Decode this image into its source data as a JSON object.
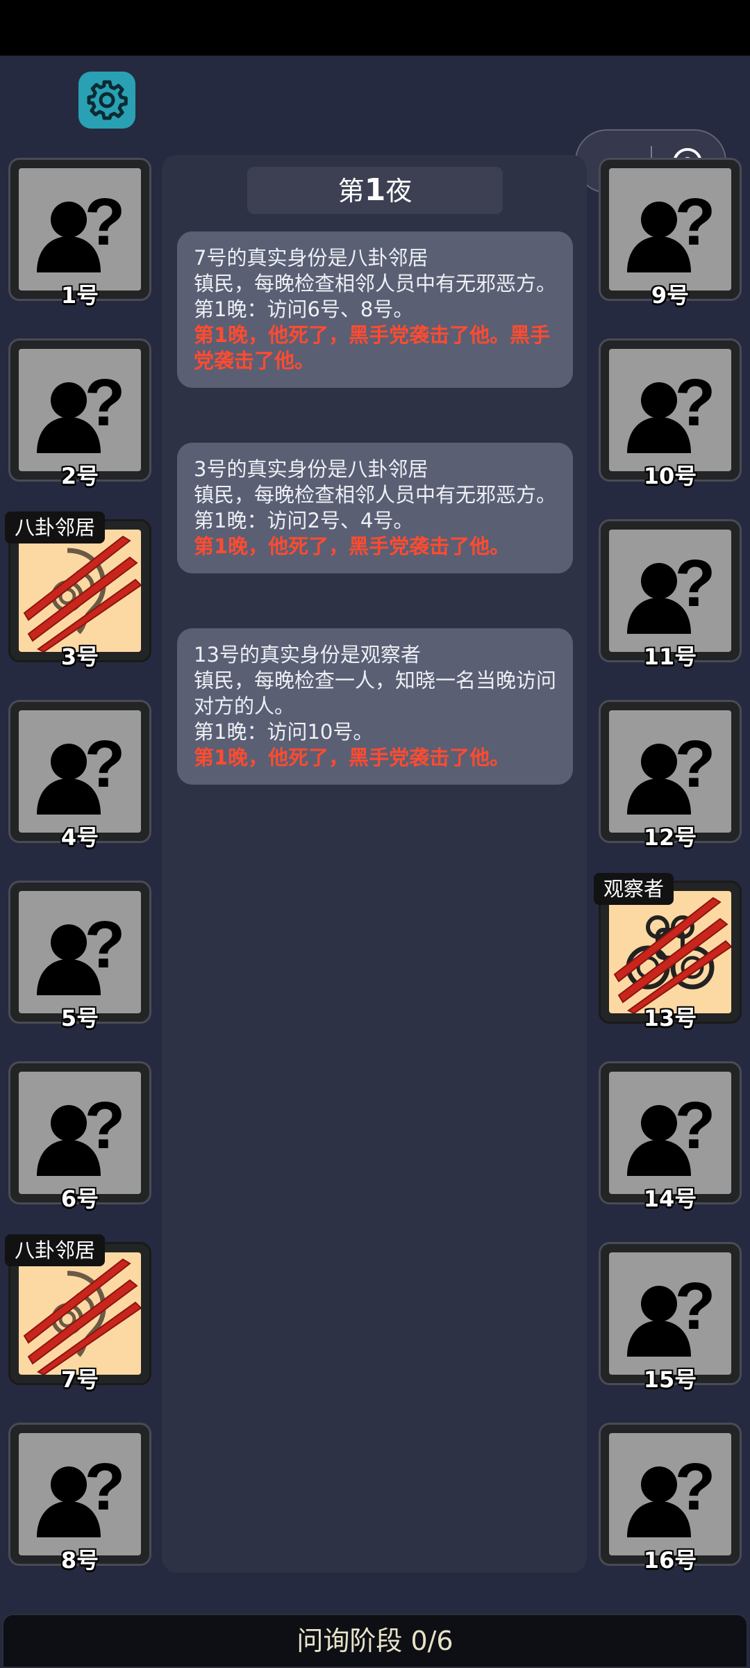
{
  "header": {
    "settings_icon": "gear-icon"
  },
  "capsule": {
    "more_icon": "more-dots-icon",
    "close_icon": "target-close-icon"
  },
  "night": {
    "prefix": "第",
    "number": "1",
    "suffix": "夜"
  },
  "reports": [
    {
      "lines": [
        "7号的真实身份是八卦邻居",
        "镇民，每晚检查相邻人员中有无邪恶方。",
        "第1晚：访问6号、8号。"
      ],
      "death": "第1晚，他死了，黑手党袭击了他。黑手党袭击了他。"
    },
    {
      "lines": [
        "3号的真实身份是八卦邻居",
        "镇民，每晚检查相邻人员中有无邪恶方。",
        "第1晚：访问2号、4号。"
      ],
      "death": "第1晚，他死了，黑手党袭击了他。"
    },
    {
      "lines": [
        "13号的真实身份是观察者",
        "镇民，每晚检查一人，知晓一名当晚访问对方的人。",
        "第1晚：访问10号。"
      ],
      "death": "第1晚，他死了，黑手党袭击了他。"
    }
  ],
  "players_left": [
    {
      "label": "1号",
      "state": "unknown",
      "role": ""
    },
    {
      "label": "2号",
      "state": "unknown",
      "role": ""
    },
    {
      "label": "3号",
      "state": "dead",
      "role": "八卦邻居",
      "icon": "ear-icon"
    },
    {
      "label": "4号",
      "state": "unknown",
      "role": ""
    },
    {
      "label": "5号",
      "state": "unknown",
      "role": ""
    },
    {
      "label": "6号",
      "state": "unknown",
      "role": ""
    },
    {
      "label": "7号",
      "state": "dead",
      "role": "八卦邻居",
      "icon": "ear-icon"
    },
    {
      "label": "8号",
      "state": "unknown",
      "role": ""
    }
  ],
  "players_right": [
    {
      "label": "9号",
      "state": "unknown",
      "role": ""
    },
    {
      "label": "10号",
      "state": "unknown",
      "role": ""
    },
    {
      "label": "11号",
      "state": "unknown",
      "role": ""
    },
    {
      "label": "12号",
      "state": "unknown",
      "role": ""
    },
    {
      "label": "13号",
      "state": "dead",
      "role": "观察者",
      "icon": "binoculars-icon"
    },
    {
      "label": "14号",
      "state": "unknown",
      "role": ""
    },
    {
      "label": "15号",
      "state": "unknown",
      "role": ""
    },
    {
      "label": "16号",
      "state": "unknown",
      "role": ""
    }
  ],
  "footer": {
    "phase": "问询阶段 0/6"
  },
  "colors": {
    "death_text": "#ff4b2f",
    "accent": "#2aa0b4",
    "revealed_bg": "#fcd9a3"
  }
}
